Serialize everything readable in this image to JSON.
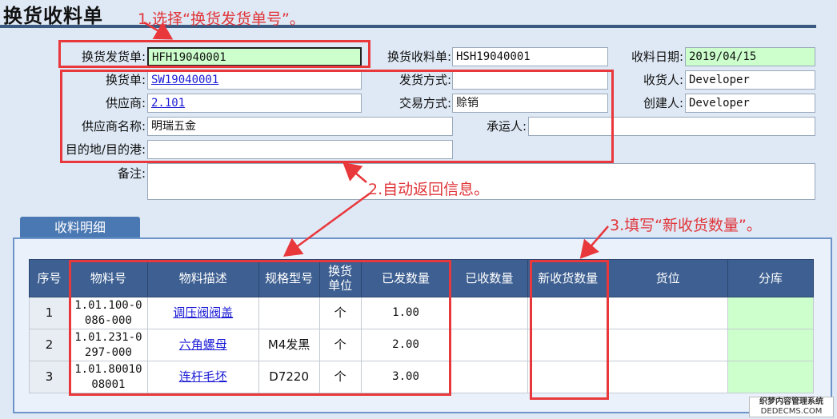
{
  "page": {
    "title": "换货收料单"
  },
  "annotations": {
    "step1": "1.选择“换货发货单号”。",
    "step2": "2.自动返回信息。",
    "step3": "3.填写“新收货数量”。"
  },
  "form": {
    "exchange_ship_no": {
      "label": "换货发货单:",
      "value": "HFH19040001"
    },
    "exchange_receipt_no": {
      "label": "换货收料单:",
      "value": "HSH19040001"
    },
    "receipt_date": {
      "label": "收料日期:",
      "value": "2019/04/15"
    },
    "exchange_no": {
      "label": "换货单:",
      "value": "SW19040001"
    },
    "ship_method": {
      "label": "发货方式:",
      "value": ""
    },
    "receiver": {
      "label": "收货人:",
      "value": "Developer"
    },
    "supplier": {
      "label": "供应商:",
      "value": "2.101"
    },
    "trade_method": {
      "label": "交易方式:",
      "value": "赊销"
    },
    "creator": {
      "label": "创建人:",
      "value": "Developer"
    },
    "supplier_name": {
      "label": "供应商名称:",
      "value": "明瑞五金"
    },
    "carrier": {
      "label": "承运人:",
      "value": ""
    },
    "destination": {
      "label": "目的地/目的港:",
      "value": ""
    },
    "remark": {
      "label": "备注:",
      "value": ""
    }
  },
  "detail": {
    "tab_label": "收料明细",
    "columns": [
      "序号",
      "物料号",
      "物料描述",
      "规格型号",
      "换货单位",
      "已发数量",
      "已收数量",
      "新收货数量",
      "货位",
      "分库"
    ],
    "rows": [
      {
        "no": "1",
        "material_no": "1.01.100-0086-000",
        "desc": "调压阀阀盖",
        "spec": "",
        "unit": "个",
        "shipped_qty": "1.00",
        "received_qty": "",
        "new_qty": "",
        "location": "",
        "warehouse": ""
      },
      {
        "no": "2",
        "material_no": "1.01.231-0297-000",
        "desc": "六角螺母",
        "spec": "M4发黑",
        "unit": "个",
        "shipped_qty": "2.00",
        "received_qty": "",
        "new_qty": "",
        "location": "",
        "warehouse": ""
      },
      {
        "no": "3",
        "material_no": "1.01.8001008001",
        "desc": "连杆毛坯",
        "spec": "D7220",
        "unit": "个",
        "shipped_qty": "3.00",
        "received_qty": "",
        "new_qty": "",
        "location": "",
        "warehouse": ""
      }
    ]
  },
  "watermark": {
    "line1": "织梦内容管理系统",
    "line2": "DEDECMS.COM"
  },
  "colors": {
    "accent": "#3d5f91",
    "highlight": "#e8383c",
    "input_green": "#ccffcc"
  }
}
